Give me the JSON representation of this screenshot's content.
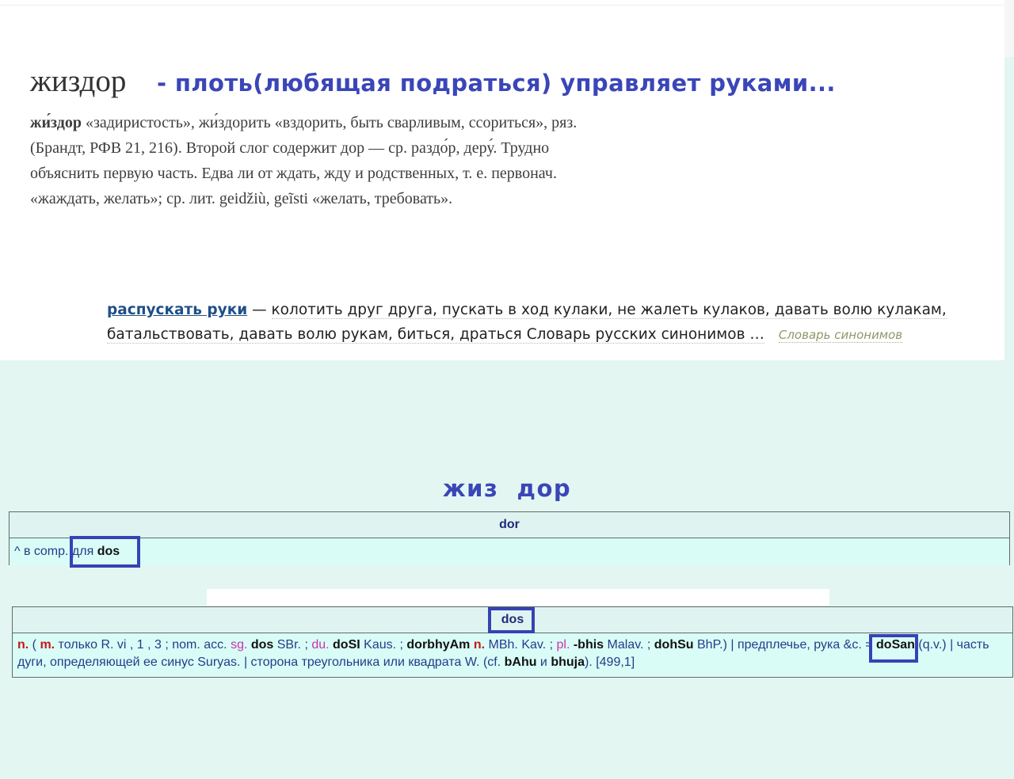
{
  "heading": {
    "headword": "жиздор",
    "annotation": "- плоть(любящая подраться) управляет руками..."
  },
  "etymology": {
    "word": "жи́здор",
    "lines": [
      " «задиристость», жи́здорить «вздорить, быть сварливым, ссориться», ряз.",
      "(Брандт, РФВ 21, 216). Второй слог содержит дор — ср. раздо́р, деру́. Трудно",
      "объяснить первую часть. Едва ли от ждать, жду и родственных, т. е. первонач.",
      "«жаждать, желать»; ср. лит. geidžiù, geĩsti «желать, требовать»."
    ]
  },
  "synonyms": {
    "term": "распускать руки",
    "dash": " — ",
    "line1": "колотить друг друга, пускать в ход кулаки, не жалеть кулаков, давать волю кулакам,",
    "line2": "батальствовать, давать волю рукам, биться, драться Словарь русских синонимов …",
    "source": "Словарь синонимов"
  },
  "split_title": "жиз  дор",
  "entry_dor": {
    "header": "dor",
    "prefix": "^ в comp. ",
    "for": "для ",
    "ref": "dos"
  },
  "entry_dos": {
    "header": "dos",
    "parts": [
      {
        "t": "n.",
        "s": "red"
      },
      {
        "t": " ( ",
        "s": ""
      },
      {
        "t": "m.",
        "s": "red"
      },
      {
        "t": " только R. vi , 1 , 3 ; nom. acc. ",
        "s": ""
      },
      {
        "t": "sg.",
        "s": "pink"
      },
      {
        "t": " ",
        "s": ""
      },
      {
        "t": "dos",
        "s": "kw"
      },
      {
        "t": " SBr. ; ",
        "s": ""
      },
      {
        "t": "du.",
        "s": "pink"
      },
      {
        "t": " ",
        "s": ""
      },
      {
        "t": "doSI",
        "s": "kw"
      },
      {
        "t": " Kaus. ; ",
        "s": ""
      },
      {
        "t": "dorbhyAm",
        "s": "kw"
      },
      {
        "t": " ",
        "s": ""
      },
      {
        "t": "n.",
        "s": "red"
      },
      {
        "t": " MBh. Kav. ; ",
        "s": ""
      },
      {
        "t": "pl.",
        "s": "pink"
      },
      {
        "t": " ",
        "s": ""
      },
      {
        "t": "-bhis",
        "s": "kw"
      },
      {
        "t": " Malav. ; ",
        "s": ""
      },
      {
        "t": "dohSu",
        "s": "kw"
      },
      {
        "t": " BhP.) | предплечье, рука &c. = ",
        "s": ""
      },
      {
        "t": "doSan",
        "s": "kw"
      },
      {
        "t": " (q.v.) | часть дуги, определяющей ее синус Suryas. | сторона треугольника или квадрата W. (cf. ",
        "s": ""
      },
      {
        "t": "bAhu",
        "s": "kw"
      },
      {
        "t": " и ",
        "s": ""
      },
      {
        "t": "bhuja",
        "s": "kw"
      },
      {
        "t": "). [499,1]",
        "s": ""
      }
    ]
  },
  "colors": {
    "annotation": "#3a46b8",
    "highlight_box": "#3742b6",
    "table_bg": "#ddfbf6",
    "page_bg": "#e3f6f1"
  }
}
